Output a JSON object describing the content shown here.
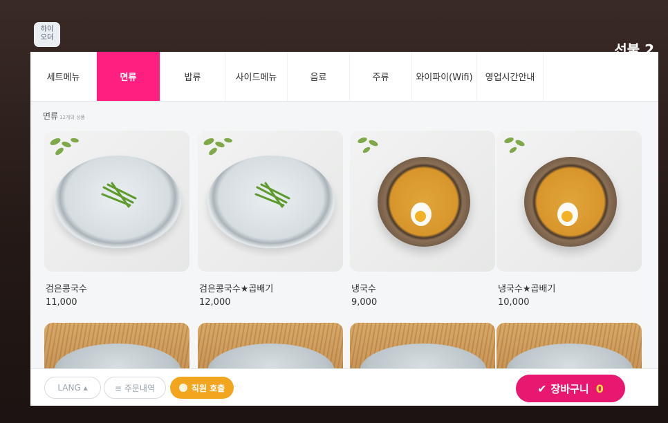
{
  "header": {
    "logo_line1": "하이",
    "logo_line2": "오더",
    "table_label": "선불 2"
  },
  "tabs": [
    {
      "label": "세트메뉴",
      "active": false
    },
    {
      "label": "면류",
      "active": true
    },
    {
      "label": "밥류",
      "active": false
    },
    {
      "label": "사이드메뉴",
      "active": false
    },
    {
      "label": "음료",
      "active": false
    },
    {
      "label": "주류",
      "active": false
    },
    {
      "label": "와이파이(Wifi)",
      "active": false
    },
    {
      "label": "영업시간안내",
      "active": false
    }
  ],
  "section": {
    "title": "면류",
    "count_text": "12개의 상품"
  },
  "products": [
    {
      "name": "검은콩국수",
      "price": "11,000",
      "image": "soy-noodle-bowl"
    },
    {
      "name": "검은콩국수★곱배기",
      "price": "12,000",
      "image": "soy-noodle-bowl"
    },
    {
      "name": "냉국수",
      "price": "9,000",
      "image": "cold-noodle-bowl"
    },
    {
      "name": "냉국수★곱배기",
      "price": "10,000",
      "image": "cold-noodle-bowl"
    }
  ],
  "footer": {
    "lang_label": "LANG ▴",
    "orders_label": "≡ 주문내역",
    "staff_label": "직원 호출",
    "cart_label": "장바구니",
    "cart_count": "0"
  },
  "colors": {
    "accent": "#ff1f80",
    "cart": "#e8176f",
    "staff": "#f2a51e",
    "cart_count": "#ffe23a"
  }
}
